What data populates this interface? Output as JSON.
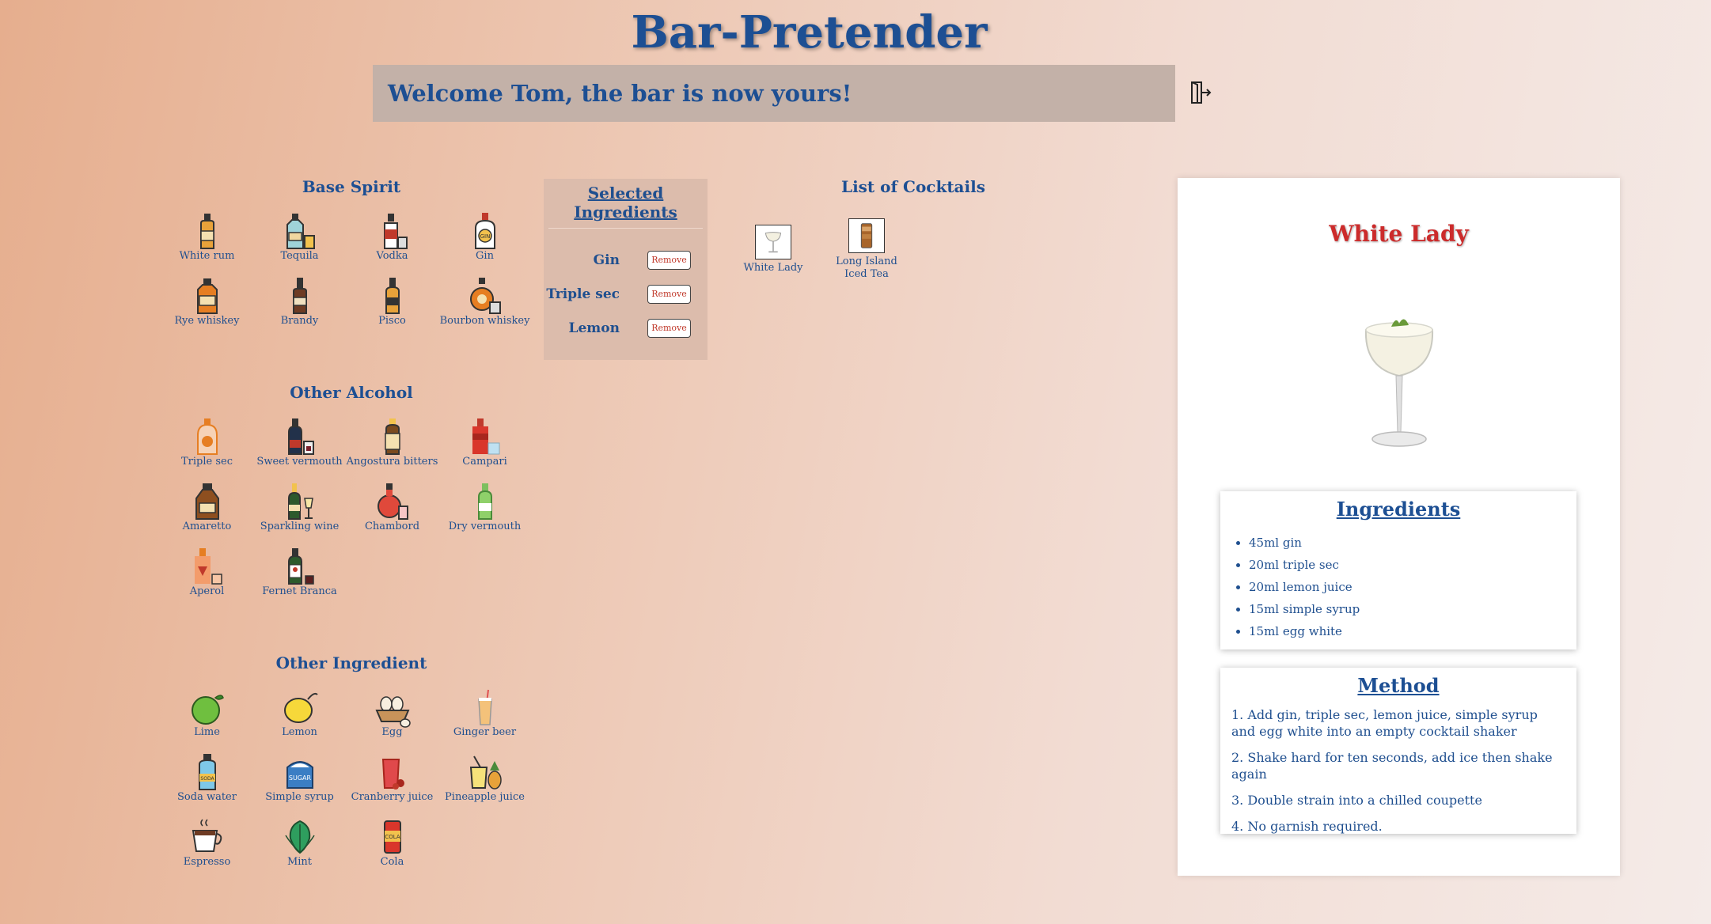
{
  "app": {
    "title": "Bar-Pretender"
  },
  "header": {
    "welcome": "Welcome Tom, the bar is now yours!"
  },
  "sections": {
    "base_spirit": {
      "title": "Base Spirit",
      "items": [
        {
          "label": "White rum",
          "icon": "rum-bottle-icon"
        },
        {
          "label": "Tequila",
          "icon": "tequila-bottle-icon"
        },
        {
          "label": "Vodka",
          "icon": "vodka-bottle-icon"
        },
        {
          "label": "Gin",
          "icon": "gin-bottle-icon"
        },
        {
          "label": "Rye whiskey",
          "icon": "whiskey-bottle-icon"
        },
        {
          "label": "Brandy",
          "icon": "brandy-bottle-icon"
        },
        {
          "label": "Pisco",
          "icon": "pisco-bottle-icon"
        },
        {
          "label": "Bourbon whiskey",
          "icon": "bourbon-bottle-icon"
        }
      ]
    },
    "other_alcohol": {
      "title": "Other Alcohol",
      "items": [
        {
          "label": "Triple sec",
          "icon": "triple-sec-bottle-icon"
        },
        {
          "label": "Sweet vermouth",
          "icon": "vermouth-bottle-icon"
        },
        {
          "label": "Angostura bitters",
          "icon": "bitters-bottle-icon"
        },
        {
          "label": "Campari",
          "icon": "campari-bottle-icon"
        },
        {
          "label": "Amaretto",
          "icon": "amaretto-bottle-icon"
        },
        {
          "label": "Sparkling wine",
          "icon": "sparkling-wine-icon"
        },
        {
          "label": "Chambord",
          "icon": "chambord-bottle-icon"
        },
        {
          "label": "Dry vermouth",
          "icon": "dry-vermouth-bottle-icon"
        },
        {
          "label": "Aperol",
          "icon": "aperol-bottle-icon"
        },
        {
          "label": "Fernet Branca",
          "icon": "fernet-bottle-icon"
        }
      ]
    },
    "other_ingredient": {
      "title": "Other Ingredient",
      "items": [
        {
          "label": "Lime",
          "icon": "lime-icon"
        },
        {
          "label": "Lemon",
          "icon": "lemon-icon"
        },
        {
          "label": "Egg",
          "icon": "egg-icon"
        },
        {
          "label": "Ginger beer",
          "icon": "ginger-beer-icon"
        },
        {
          "label": "Soda water",
          "icon": "soda-water-icon"
        },
        {
          "label": "Simple syrup",
          "icon": "sugar-icon"
        },
        {
          "label": "Cranberry juice",
          "icon": "cranberry-juice-icon"
        },
        {
          "label": "Pineapple juice",
          "icon": "pineapple-juice-icon"
        },
        {
          "label": "Espresso",
          "icon": "coffee-cup-icon"
        },
        {
          "label": "Mint",
          "icon": "mint-leaf-icon"
        },
        {
          "label": "Cola",
          "icon": "cola-can-icon"
        }
      ]
    }
  },
  "selected": {
    "title": "Selected Ingredients",
    "remove_label": "Remove",
    "items": [
      "Gin",
      "Triple sec",
      "Lemon"
    ]
  },
  "cocktails": {
    "title": "List of Cocktails",
    "items": [
      {
        "name": "White Lady",
        "icon": "cocktail-glass-icon"
      },
      {
        "name": "Long Island Iced Tea",
        "icon": "iced-tea-glass-icon"
      }
    ]
  },
  "detail": {
    "name": "White Lady",
    "image": "coupe-glass-icon",
    "ingredients_title": "Ingredients",
    "ingredients": [
      "45ml gin",
      "20ml triple sec",
      "20ml lemon juice",
      "15ml simple syrup",
      "15ml egg white"
    ],
    "method_title": "Method",
    "method": [
      "1. Add gin, triple sec, lemon juice, simple syrup and egg white into an empty cocktail shaker",
      "2. Shake hard for ten seconds, add ice then shake again",
      "3. Double strain into a chilled coupette",
      "4. No garnish required."
    ]
  },
  "colors": {
    "primary": "#1d4f93",
    "accent_red": "#cc2b2b",
    "welcome_bg": "#c3b1a8",
    "selected_bg": "#dcbcac"
  }
}
